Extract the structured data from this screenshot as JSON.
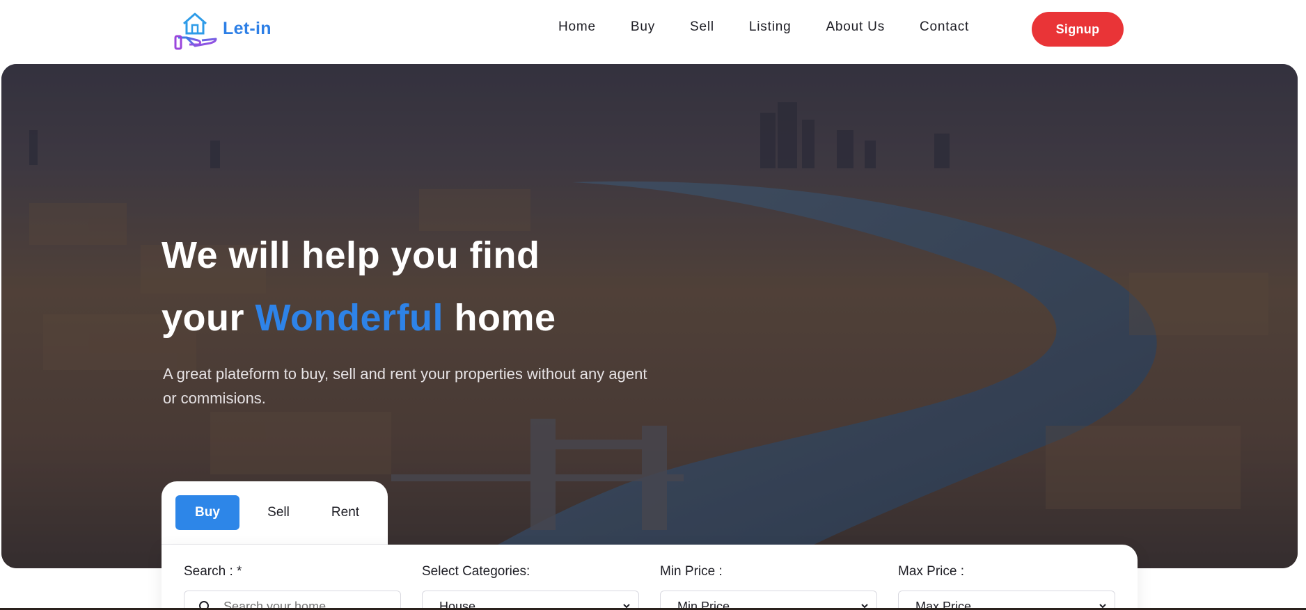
{
  "brand": {
    "name": "Let-in",
    "colors": {
      "primary": "#2d7fe6",
      "accent_red": "#e93437",
      "icon_gradient_start": "#2d7fe6",
      "icon_gradient_end": "#b443e0"
    }
  },
  "nav": {
    "items": [
      "Home",
      "Buy",
      "Sell",
      "Listing",
      "About Us",
      "Contact"
    ],
    "signup_label": "Signup"
  },
  "hero": {
    "title_line1": "We will help you find",
    "title_line2_pre": "your ",
    "title_line2_accent": "Wonderful",
    "title_line2_post": " home",
    "subtitle": "A great plateform to buy, sell and rent your properties without any agent or commisions."
  },
  "search": {
    "tabs": [
      {
        "label": "Buy",
        "active": true
      },
      {
        "label": "Sell",
        "active": false
      },
      {
        "label": "Rent",
        "active": false
      }
    ],
    "fields": {
      "search": {
        "label": "Search : *",
        "placeholder": "Search your home"
      },
      "category": {
        "label": "Select Categories:",
        "value": "House"
      },
      "min_price": {
        "label": "Min Price :",
        "value": "Min Price"
      },
      "max_price": {
        "label": "Max Price :",
        "value": "Max Price"
      }
    }
  }
}
